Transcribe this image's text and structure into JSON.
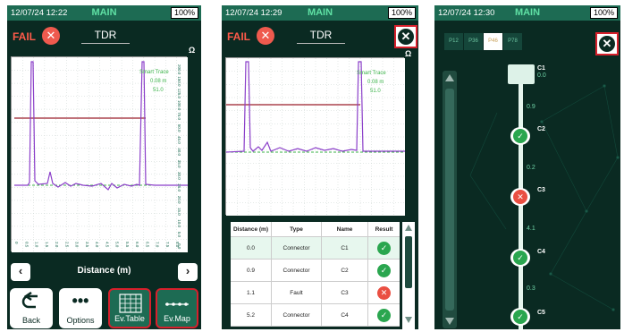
{
  "panel1": {
    "time": "12/07/24 12:22",
    "app_title": "MAIN",
    "battery": "100%",
    "fail_label": "FAIL",
    "title": "TDR",
    "ohm_unit": "Ω",
    "smart_trace": [
      "Smart Trace",
      "0.08 m",
      "51.0"
    ],
    "y_ticks": [
      "200.0",
      "150.0",
      "125.0",
      "100.0",
      "75.0",
      "50.0",
      "45.0",
      "40.0",
      "35.0",
      "30.0",
      "25.0",
      "20.0",
      "15.0",
      "10.0",
      "5.0",
      "0.0"
    ],
    "x_ticks": [
      "0",
      "0.5",
      "1.0",
      "1.5",
      "2.0",
      "2.5",
      "3.0",
      "3.5",
      "4.0",
      "4.5",
      "5.0",
      "5.5",
      "6.0",
      "6.5",
      "7.0",
      "7.5",
      "8.0"
    ],
    "x_axis_label": "Distance (m)",
    "nav_prev": "‹",
    "nav_next": "›",
    "buttons": [
      {
        "label": "Back",
        "icon": "back-arrow-icon"
      },
      {
        "label": "Options",
        "icon": "ellipsis-icon"
      },
      {
        "label": "Ev.Table",
        "icon": "grid-table-icon"
      },
      {
        "label": "Ev.Map",
        "icon": "dotted-line-icon"
      }
    ]
  },
  "panel2": {
    "time": "12/07/24 12:29",
    "app_title": "MAIN",
    "battery": "100%",
    "fail_label": "FAIL",
    "title": "TDR",
    "ohm_unit": "Ω",
    "smart_trace": [
      "Smart Trace",
      "0.08 m",
      "51.0"
    ],
    "table": {
      "headers": [
        "Distance (m)",
        "Type",
        "Name",
        "Result"
      ],
      "rows": [
        {
          "distance": "0.0",
          "type": "Connector",
          "name": "C1",
          "result": "pass"
        },
        {
          "distance": "0.9",
          "type": "Connector",
          "name": "C2",
          "result": "pass"
        },
        {
          "distance": "1.1",
          "type": "Fault",
          "name": "C3",
          "result": "fail"
        },
        {
          "distance": "5.2",
          "type": "Connector",
          "name": "C4",
          "result": "pass"
        }
      ]
    }
  },
  "panel3": {
    "time": "12/07/24 12:30",
    "app_title": "MAIN",
    "battery": "100%",
    "tabs": [
      "P12",
      "P36",
      "P46",
      "P78"
    ],
    "active_tab": "P46",
    "nodes": [
      {
        "name": "C1",
        "value": "0.0",
        "result": "none"
      },
      {
        "name": "C2",
        "value": "",
        "result": "pass"
      },
      {
        "name": "C3",
        "value": "",
        "result": "fail"
      },
      {
        "name": "C4",
        "value": "",
        "result": "pass"
      },
      {
        "name": "C5",
        "value": "",
        "result": "pass"
      }
    ],
    "segments": [
      "0.9",
      "0.2",
      "4.1",
      "0.3"
    ]
  },
  "colors": {
    "background": "#0a2a22",
    "status_bar": "#1d6b53",
    "accent_green": "#5fe0a4",
    "fail_red": "#ef5a4e",
    "highlight_border": "#d6202c",
    "trace_purple": "#8b3fc9",
    "threshold_red": "#9b1f2a"
  }
}
